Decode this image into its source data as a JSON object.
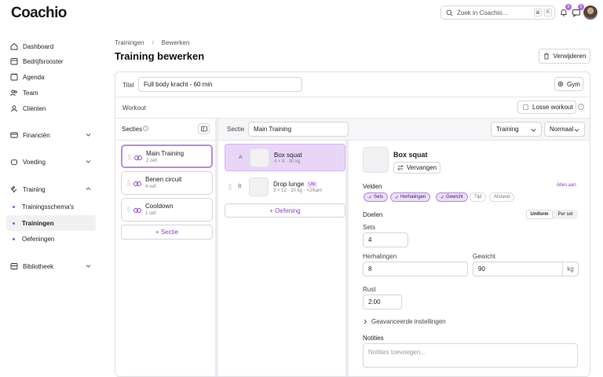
{
  "app": {
    "logo": "Coachio"
  },
  "topbar": {
    "search_placeholder": "Zoek in Coachio...",
    "kbd_1": "⌘",
    "kbd_2": "K",
    "notif_badge": "5",
    "messages_badge": "5"
  },
  "sidebar": {
    "items": [
      {
        "label": "Dashboard"
      },
      {
        "label": "Bedrijfsrooster"
      },
      {
        "label": "Agenda"
      },
      {
        "label": "Team"
      },
      {
        "label": "Cliënten"
      },
      {
        "label": "Financiën"
      },
      {
        "label": "Voeding"
      },
      {
        "label": "Training"
      },
      {
        "label": "Bibliotheek"
      }
    ],
    "training_sub": [
      {
        "label": "Trainingsschema's"
      },
      {
        "label": "Trainingen"
      },
      {
        "label": "Oefeningen"
      }
    ]
  },
  "breadcrumb": [
    "Trainingen",
    "Bewerken"
  ],
  "page_title": "Training bewerken",
  "delete_label": "Verwijderen",
  "form": {
    "title_label": "Titel",
    "title_value": "Full body kracht - 60 min",
    "gym_label": "Gym",
    "workout_label": "Workout",
    "losse_workout_label": "Losse workout"
  },
  "sections": {
    "header": "Secties",
    "items": [
      {
        "name": "Main Training",
        "count": "2 oef."
      },
      {
        "name": "Benen circuit",
        "count": "4 oef."
      },
      {
        "name": "Cooldown",
        "count": "1 oef."
      }
    ],
    "add_label": "+ Sectie"
  },
  "section_bar": {
    "label": "Sectie",
    "value": "Main Training",
    "type_select": "Training",
    "mode_select": "Normaal"
  },
  "exercises": {
    "items": [
      {
        "letter": "A",
        "name": "Box squat",
        "detail": "4 × 8 · 90 kg",
        "uni": ""
      },
      {
        "letter": "B",
        "name": "Drop lunge",
        "detail": "3 × 12 · 20 kg · ×2/kant",
        "uni": "UNI"
      }
    ],
    "add_label": "+ Oefening"
  },
  "detail": {
    "name": "Box squat",
    "replace_label": "Vervangen",
    "fields_label": "Velden",
    "all_on_label": "Alles aan",
    "chips": [
      {
        "label": "Sets",
        "on": true
      },
      {
        "label": "Herhalingen",
        "on": true
      },
      {
        "label": "Gewicht",
        "on": true
      },
      {
        "label": "Tijd",
        "on": false
      },
      {
        "label": "Afstand",
        "on": false
      }
    ],
    "goals_label": "Doelen",
    "seg_uniform": "Uniform",
    "seg_per_set": "Per set",
    "sets_label": "Sets",
    "sets_value": "4",
    "reps_label": "Herhalingen",
    "reps_value": "8",
    "weight_label": "Gewicht",
    "weight_value": "90",
    "weight_unit": "kg",
    "rest_label": "Rust",
    "rest_value": "2:00",
    "advanced_label": "Geavanceerde instellingen",
    "notes_label": "Notities",
    "notes_placeholder": "Notities toevoegen..."
  },
  "colors": {
    "accent": "#8a3fd0",
    "accent_soft": "#e8d6f7"
  }
}
